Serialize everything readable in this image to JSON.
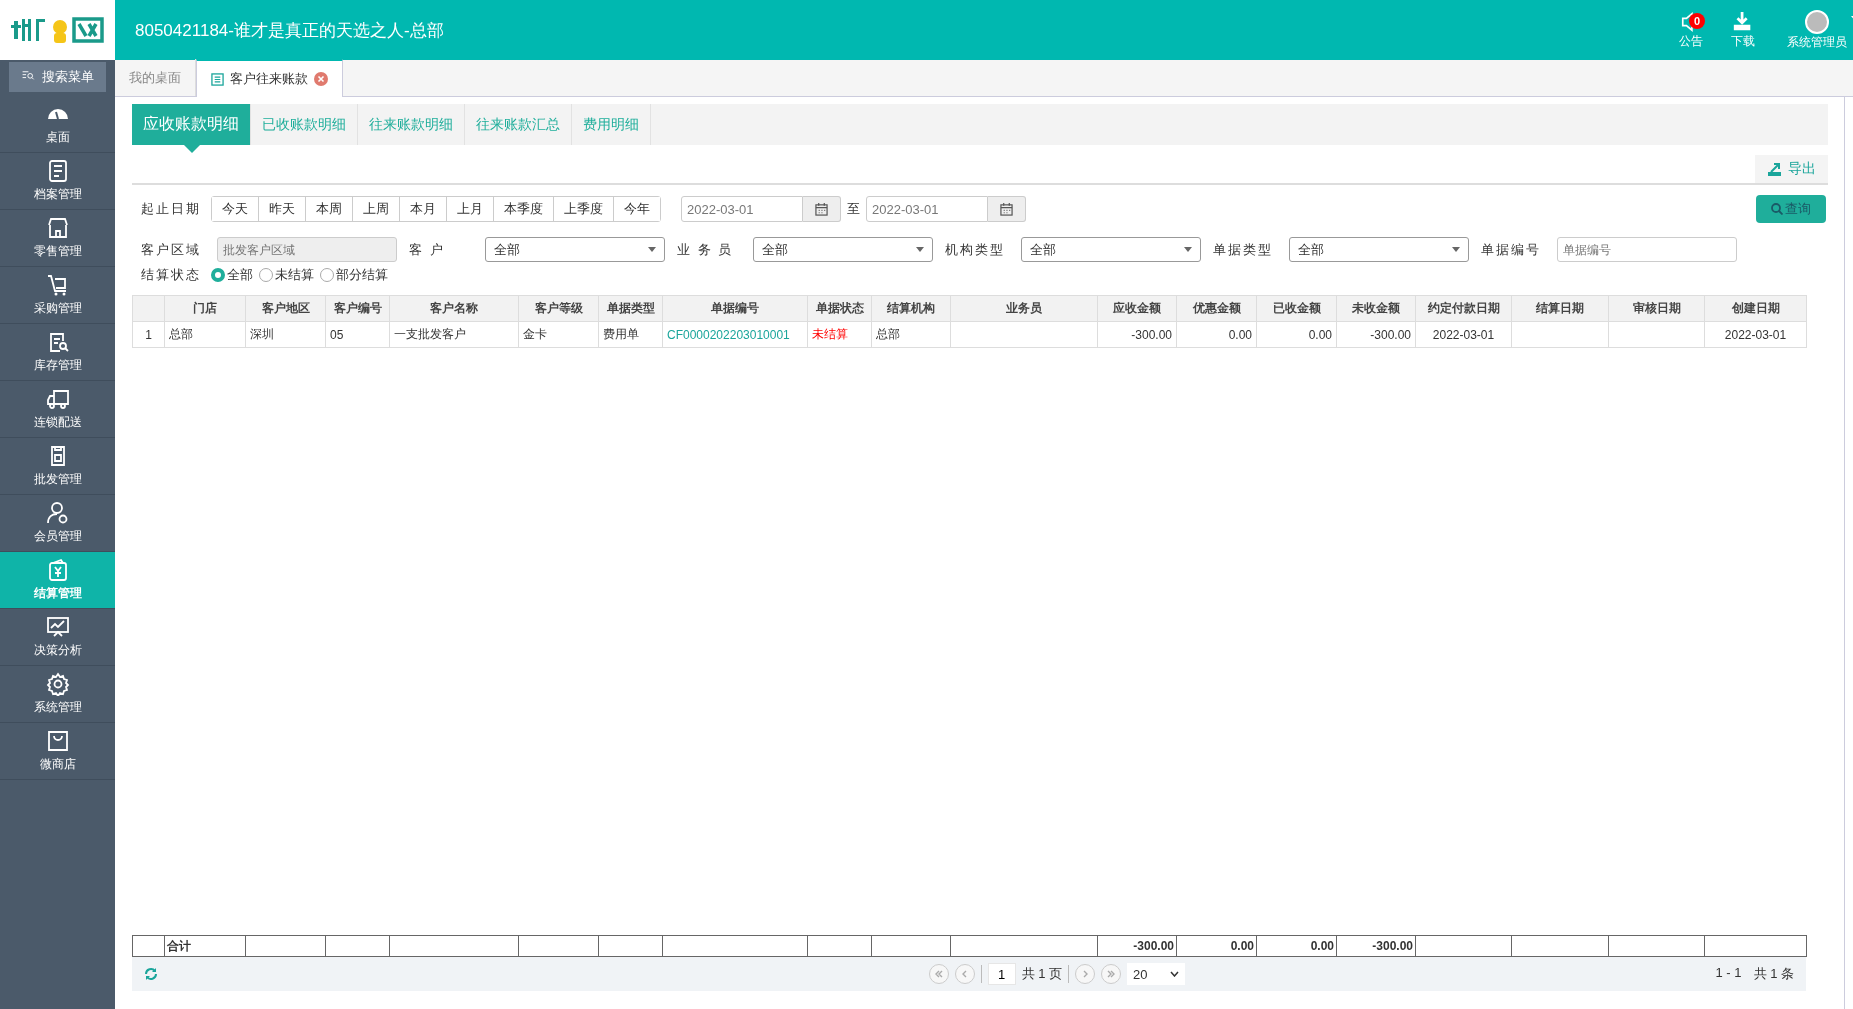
{
  "header": {
    "title": "8050421184-谁才是真正的天选之人-总部",
    "notice": {
      "label": "公告",
      "badge": "0"
    },
    "download": {
      "label": "下载"
    },
    "user": {
      "label": "系统管理员"
    }
  },
  "sidebar": {
    "search_label": "搜索菜单",
    "items": [
      {
        "label": "桌面",
        "selected": false
      },
      {
        "label": "档案管理",
        "selected": false
      },
      {
        "label": "零售管理",
        "selected": false
      },
      {
        "label": "采购管理",
        "selected": false
      },
      {
        "label": "库存管理",
        "selected": false
      },
      {
        "label": "连锁配送",
        "selected": false
      },
      {
        "label": "批发管理",
        "selected": false
      },
      {
        "label": "会员管理",
        "selected": false
      },
      {
        "label": "结算管理",
        "selected": true
      },
      {
        "label": "决策分析",
        "selected": false
      },
      {
        "label": "系统管理",
        "selected": false
      },
      {
        "label": "微商店",
        "selected": false
      }
    ]
  },
  "page_tabs": [
    {
      "label": "我的桌面",
      "selected": false,
      "closable": false
    },
    {
      "label": "客户往来账款",
      "selected": true,
      "closable": true
    }
  ],
  "sub_tabs": [
    {
      "label": "应收账款明细",
      "selected": true
    },
    {
      "label": "已收账款明细",
      "selected": false
    },
    {
      "label": "往来账款明细",
      "selected": false
    },
    {
      "label": "往来账款汇总",
      "selected": false
    },
    {
      "label": "费用明细",
      "selected": false
    }
  ],
  "toolbar": {
    "export_label": "导出"
  },
  "filters": {
    "date_label": "起止日期",
    "quick_ranges": [
      "今天",
      "昨天",
      "本周",
      "上周",
      "本月",
      "上月",
      "本季度",
      "上季度",
      "今年"
    ],
    "date_from": "2022-03-01",
    "date_sep": "至",
    "date_to": "2022-03-01",
    "query_label": "查询",
    "fields": [
      {
        "label": "客户区域",
        "kind": "text",
        "placeholder": "批发客户区域",
        "disabled": true
      },
      {
        "label": "客 户",
        "kind": "select",
        "value": "全部"
      },
      {
        "label": "业 务 员",
        "kind": "select",
        "value": "全部"
      },
      {
        "label": "机构类型",
        "kind": "select",
        "value": "全部"
      },
      {
        "label": "单据类型",
        "kind": "select",
        "value": "全部"
      },
      {
        "label": "单据编号",
        "kind": "text",
        "placeholder": "单据编号",
        "disabled": false
      }
    ],
    "status_label": "结算状态",
    "status_options": [
      {
        "label": "全部",
        "selected": true
      },
      {
        "label": "未结算",
        "selected": false
      },
      {
        "label": "部分结算",
        "selected": false
      }
    ]
  },
  "table": {
    "columns": [
      "门店",
      "客户地区",
      "客户编号",
      "客户名称",
      "客户等级",
      "单据类型",
      "单据编号",
      "单据状态",
      "结算机构",
      "业务员",
      "应收金额",
      "优惠金额",
      "已收金额",
      "未收金额",
      "约定付款日期",
      "结算日期",
      "审核日期",
      "创建日期"
    ],
    "rows": [
      {
        "number": "1",
        "cells": {
          "门店": {
            "text": "总部",
            "kind": "plain"
          },
          "客户地区": {
            "text": "深圳",
            "kind": "plain"
          },
          "客户编号": {
            "text": "05",
            "kind": "plain"
          },
          "客户名称": {
            "text": "一支批发客户",
            "kind": "plain"
          },
          "客户等级": {
            "text": "金卡",
            "kind": "plain"
          },
          "单据类型": {
            "text": "费用单",
            "kind": "plain"
          },
          "单据编号": {
            "text": "CF0000202203010001",
            "kind": "link"
          },
          "单据状态": {
            "text": "未结算",
            "kind": "alert"
          },
          "结算机构": {
            "text": "总部",
            "kind": "plain"
          },
          "应收金额": {
            "text": "-300.00",
            "kind": "amount"
          },
          "优惠金额": {
            "text": "0.00",
            "kind": "amount"
          },
          "已收金额": {
            "text": "0.00",
            "kind": "amount"
          },
          "未收金额": {
            "text": "-300.00",
            "kind": "amount"
          },
          "约定付款日期": {
            "text": "2022-03-01",
            "kind": "date"
          },
          "创建日期": {
            "text": "2022-03-01",
            "kind": "date"
          }
        }
      }
    ],
    "totals": {
      "label": "合计",
      "values": {
        "应收金额": "-300.00",
        "优惠金额": "0.00",
        "已收金额": "0.00",
        "未收金额": "-300.00"
      }
    }
  },
  "pager": {
    "page": "1",
    "pages": "共 1 页",
    "page_size": "20",
    "range": "1 - 1",
    "total": "共 1 条"
  }
}
